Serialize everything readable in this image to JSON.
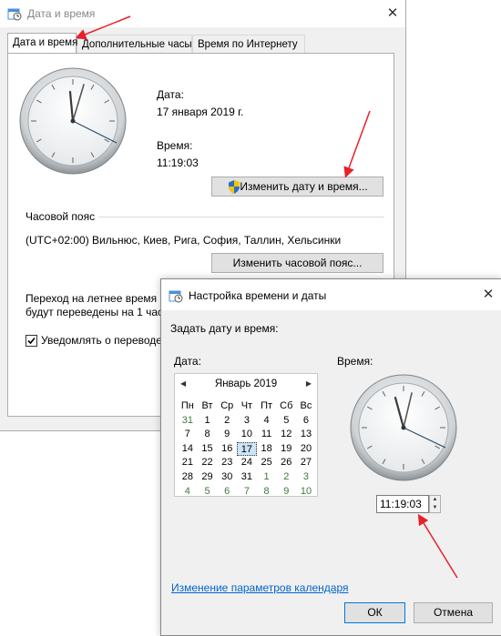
{
  "main_window": {
    "title": "Дата и время",
    "close": "✕",
    "tabs": [
      "Дата и время",
      "Дополнительные часы",
      "Время по Интернету"
    ],
    "date_label": "Дата:",
    "date_value": "17 января 2019 г.",
    "time_label": "Время:",
    "time_value": "11:19:03",
    "change_datetime_button": "Изменить дату и время...",
    "timezone_label": "Часовой пояс",
    "timezone_value": "(UTC+02:00) Вильнюс, Киев, Рига, София, Таллин, Хельсинки",
    "change_timezone_button": "Изменить часовой пояс...",
    "dst_text_line1": "Переход на летнее время п",
    "dst_text_line2": "будут переведены на 1 час",
    "notify_checkbox_label": "Уведомлять о переводе",
    "notify_checked": true
  },
  "dialog": {
    "title": "Настройка времени и даты",
    "close": "✕",
    "heading": "Задать дату и время:",
    "date_label": "Дата:",
    "time_label": "Время:",
    "calendar": {
      "month": "Январь 2019",
      "prev": "◀",
      "next": "▶",
      "weekdays": [
        "Пн",
        "Вт",
        "Ср",
        "Чт",
        "Пт",
        "Сб",
        "Вс"
      ],
      "weeks": [
        [
          "31",
          "1",
          "2",
          "3",
          "4",
          "5",
          "6"
        ],
        [
          "7",
          "8",
          "9",
          "10",
          "11",
          "12",
          "13"
        ],
        [
          "14",
          "15",
          "16",
          "17",
          "18",
          "19",
          "20"
        ],
        [
          "21",
          "22",
          "23",
          "24",
          "25",
          "26",
          "27"
        ],
        [
          "28",
          "29",
          "30",
          "31",
          "1",
          "2",
          "3"
        ],
        [
          "4",
          "5",
          "6",
          "7",
          "8",
          "9",
          "10"
        ]
      ],
      "selected_day": "17"
    },
    "time_value": "11:19:03",
    "spin_up": "▲",
    "spin_down": "▼",
    "calendar_settings_link": "Изменение параметров календаря",
    "ok_button": "ОК",
    "cancel_button": "Отмена"
  },
  "colors": {
    "arrow": "#e8202a",
    "link": "#0066cc",
    "dialog_bg": "#f0f0f0"
  }
}
